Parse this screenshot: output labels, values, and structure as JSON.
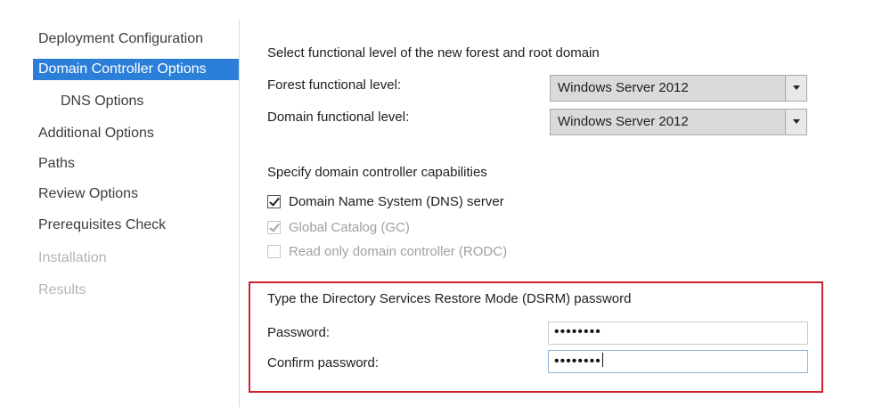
{
  "nav": {
    "items": [
      {
        "label": "Deployment Configuration"
      },
      {
        "label": "Domain Controller Options"
      },
      {
        "label": "DNS Options"
      },
      {
        "label": "Additional Options"
      },
      {
        "label": "Paths"
      },
      {
        "label": "Review Options"
      },
      {
        "label": "Prerequisites Check"
      },
      {
        "label": "Installation"
      },
      {
        "label": "Results"
      }
    ],
    "active_index": 1
  },
  "functional": {
    "heading": "Select functional level of the new forest and root domain",
    "forest_label": "Forest functional level:",
    "forest_value": "Windows Server 2012",
    "domain_label": "Domain functional level:",
    "domain_value": "Windows Server 2012"
  },
  "capabilities": {
    "heading": "Specify domain controller capabilities",
    "items": [
      {
        "label": "Domain Name System (DNS) server",
        "checked": true,
        "enabled": true
      },
      {
        "label": "Global Catalog (GC)",
        "checked": true,
        "enabled": false
      },
      {
        "label": "Read only domain controller (RODC)",
        "checked": false,
        "enabled": false
      }
    ]
  },
  "dsrm": {
    "heading": "Type the Directory Services Restore Mode (DSRM) password",
    "password_label": "Password:",
    "password_value": "••••••••",
    "confirm_label": "Confirm password:",
    "confirm_value": "••••••••"
  },
  "colors": {
    "accent": "#2b7fd8",
    "highlight_border": "#d0202a"
  }
}
